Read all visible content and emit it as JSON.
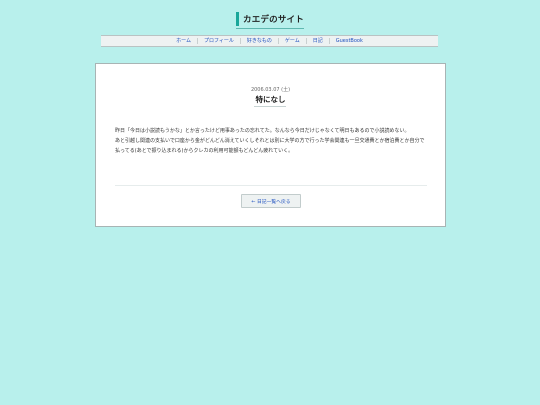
{
  "site": {
    "title": "カエデのサイト"
  },
  "nav": {
    "items": [
      {
        "label": "ホーム"
      },
      {
        "label": "プロフィール"
      },
      {
        "label": "好きなもの"
      },
      {
        "label": "ゲーム"
      },
      {
        "label": "日記"
      },
      {
        "label": "GuestBook"
      }
    ]
  },
  "post": {
    "date": "2006.03.07 (土)",
    "title": "特になし",
    "paragraphs": [
      "昨日「今日は小説読もうかな」とか言ったけど用事あったの忘れてた。なんなら今日だけじゃなくて明日もあるので小説読めない。",
      "あと引越し関連の支払いで口座から金がどんどん消えていくしそれとは別に大学の方で行った学会関連も一旦交通費とか宿泊費とか自分で払ってる(あとで振り込まれる)からクレカの利用可能額もどんどん疲れていく。"
    ]
  },
  "footer": {
    "back_label": "← 日記一覧へ戻る"
  },
  "colors": {
    "background": "#b8f0ec",
    "accent": "#19a79a",
    "link": "#1c4fbf"
  }
}
